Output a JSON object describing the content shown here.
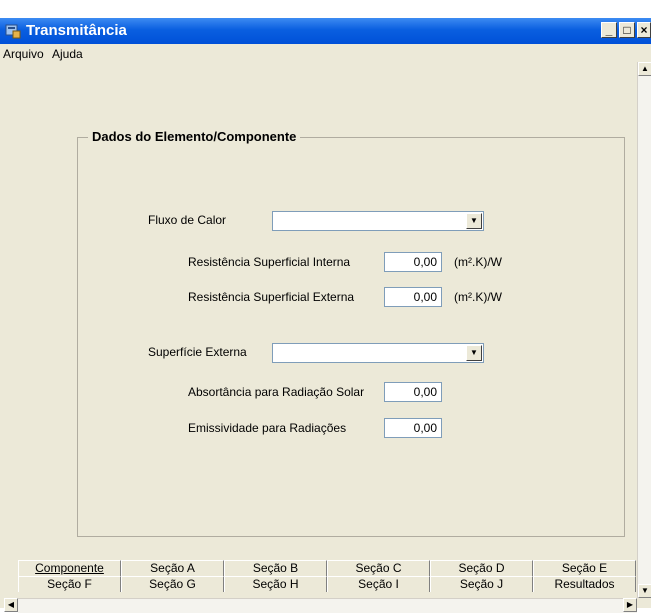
{
  "window": {
    "title": "Transmitância",
    "controls": {
      "minimize": "_",
      "maximize": "□",
      "close": "×"
    }
  },
  "menu": {
    "items": [
      "Arquivo",
      "Ajuda"
    ]
  },
  "group": {
    "title": "Dados do Elemento/Componente",
    "fluxo_label": "Fluxo de Calor",
    "fluxo_value": "",
    "rsi_label": "Resistência Superficial Interna",
    "rsi_value": "0,00",
    "rsi_unit": "(m².K)/W",
    "rse_label": "Resistência Superficial Externa",
    "rse_value": "0,00",
    "rse_unit": "(m².K)/W",
    "superficie_label": "Superfície Externa",
    "superficie_value": "",
    "absortancia_label": "Absortância para Radiação Solar",
    "absortancia_value": "0,00",
    "emissividade_label": "Emissividade para Radiações",
    "emissividade_value": "0,00"
  },
  "tabs": {
    "row1": [
      "Componente",
      "Seção A",
      "Seção B",
      "Seção C",
      "Seção D",
      "Seção E"
    ],
    "row2": [
      "Seção F",
      "Seção G",
      "Seção H",
      "Seção I",
      "Seção J",
      "Resultados"
    ],
    "active": "Componente"
  },
  "icons": {
    "app": "transmittance-app-icon",
    "dropdown": "chevron-down-icon",
    "scroll_up": "arrow-up-icon",
    "scroll_down": "arrow-down-icon",
    "scroll_left": "arrow-left-icon",
    "scroll_right": "arrow-right-icon"
  },
  "colors": {
    "titlebar": "#0a5fe0",
    "face": "#ece9d8",
    "field_border": "#7f9db9"
  }
}
